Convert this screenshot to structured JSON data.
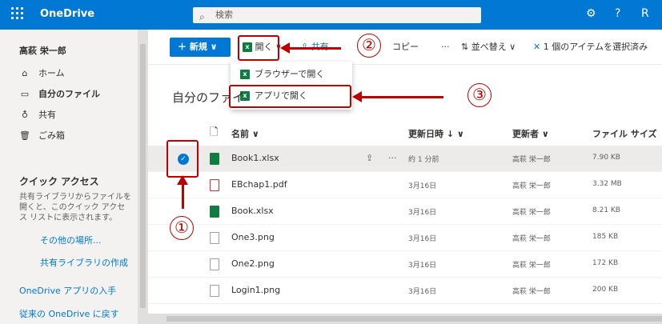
{
  "header": {
    "brand": "OneDrive",
    "search_placeholder": "検索",
    "settings_icon": "⚙",
    "help_icon": "?",
    "account_icon": "R"
  },
  "sidebar": {
    "user": "高萩 栄一郎",
    "items": [
      {
        "icon": "⌂",
        "label": "ホーム"
      },
      {
        "icon": "▭",
        "label": "自分のファイル",
        "active": true
      },
      {
        "icon": "♁",
        "label": "共有"
      },
      {
        "icon": "🗑",
        "label": "ごみ箱"
      }
    ],
    "quick_access_title": "クイック アクセス",
    "quick_access_desc": "共有ライブラリからファイルを開くと、このクイック アクセス リストに表示されます。",
    "other_places": "その他の場所...",
    "create_library": "共有ライブラリの作成",
    "get_apps": "OneDrive アプリの入手",
    "back_classic": "従来の OneDrive に戻す"
  },
  "commandbar": {
    "new_label": "＋ 新規 ∨",
    "open_label": "開く ∨",
    "share_label": "共有",
    "copy_label": "コピー",
    "more": "···",
    "sort_label": "並べ替え ∨",
    "selected_label": "1 個のアイテムを選択済み"
  },
  "dropdown": {
    "item1": "ブラウザーで開く",
    "item2": "アプリで開く"
  },
  "breadcrumb": "自分のファイ",
  "columns": {
    "name": "名前 ∨",
    "modified": "更新日時 ↓ ∨",
    "modified_by": "更新者 ∨",
    "size": "ファイル サイズ"
  },
  "files": [
    {
      "name": "Book1.xlsx",
      "modified": "約 1 分前",
      "by": "高萩 栄一郎",
      "size": "7.90 KB",
      "type": "x",
      "selected": true
    },
    {
      "name": "EBchap1.pdf",
      "modified": "3月16日",
      "by": "高萩 栄一郎",
      "size": "3.32 MB",
      "type": "p"
    },
    {
      "name": "Book.xlsx",
      "modified": "3月16日",
      "by": "高萩 栄一郎",
      "size": "8.21 KB",
      "type": "x"
    },
    {
      "name": "One3.png",
      "modified": "3月16日",
      "by": "高萩 栄一郎",
      "size": "185 KB",
      "type": "i"
    },
    {
      "name": "One2.png",
      "modified": "3月16日",
      "by": "高萩 栄一郎",
      "size": "172 KB",
      "type": "i"
    },
    {
      "name": "Login1.png",
      "modified": "3月16日",
      "by": "高萩 栄一郎",
      "size": "200 KB",
      "type": "i"
    }
  ],
  "annotations": {
    "one": "①",
    "two": "②",
    "three": "③"
  },
  "colors": {
    "brand": "#0078d4",
    "annotation": "#c00000",
    "excel": "#107c41"
  }
}
